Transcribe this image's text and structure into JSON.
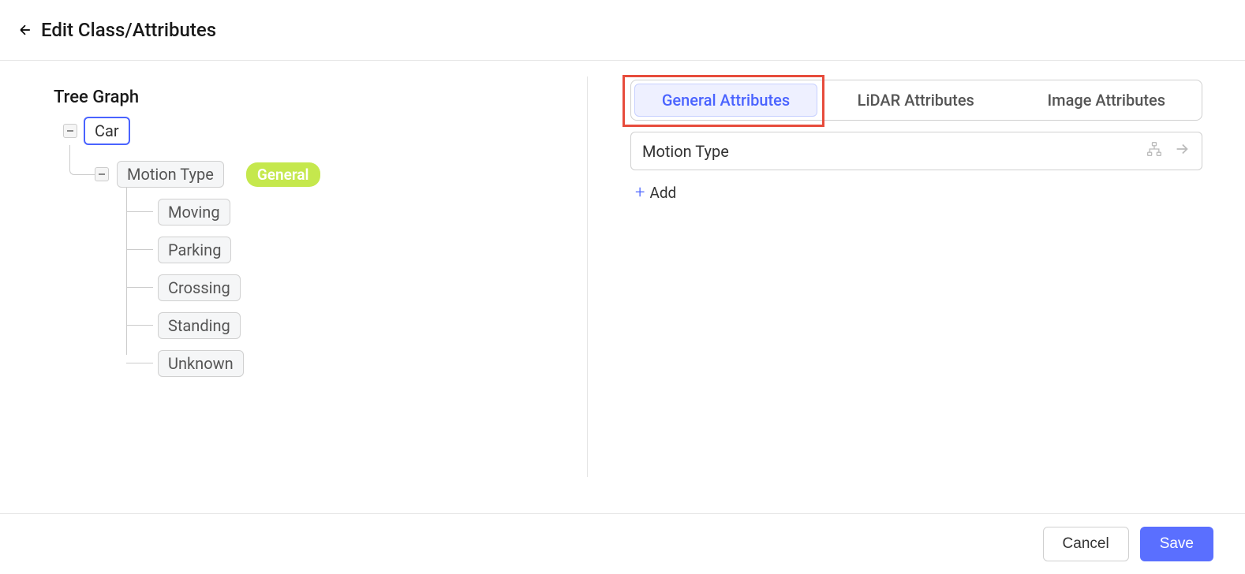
{
  "header": {
    "title": "Edit Class/Attributes"
  },
  "tree": {
    "title": "Tree Graph",
    "root": "Car",
    "level1": {
      "label": "Motion Type",
      "badge": "General"
    },
    "level2": [
      "Moving",
      "Parking",
      "Crossing",
      "Standing",
      "Unknown"
    ]
  },
  "tabs": {
    "general": "General Attributes",
    "lidar": "LiDAR Attributes",
    "image": "Image Attributes"
  },
  "attribute_row": "Motion Type",
  "add_label": "Add",
  "footer": {
    "cancel": "Cancel",
    "save": "Save"
  }
}
